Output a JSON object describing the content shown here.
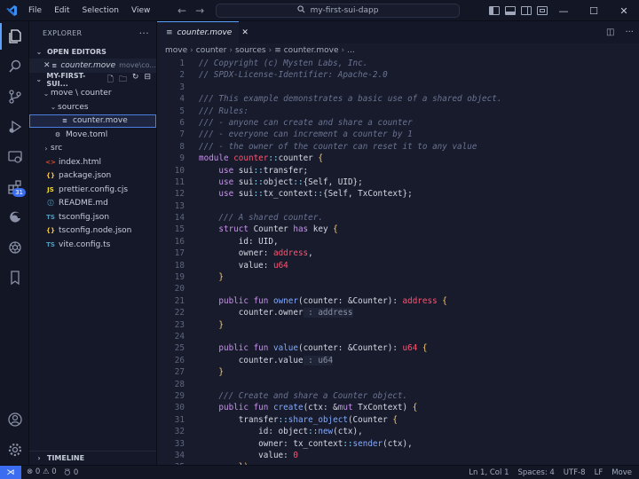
{
  "titlebar": {
    "menu": [
      "File",
      "Edit",
      "Selection",
      "View"
    ],
    "command_center": "my-first-sui-dapp",
    "window_controls": [
      "minimize",
      "maximize",
      "close"
    ]
  },
  "activity_bar": {
    "items": [
      "explorer-icon",
      "search-icon",
      "source-control-icon",
      "run-debug-icon",
      "remote-explorer-icon",
      "extensions-icon",
      "edge-icon",
      "openai-icon",
      "bookmark-icon"
    ],
    "extensions_badge": "31",
    "bottom": [
      "account-icon",
      "manage-gear-icon"
    ]
  },
  "sidebar": {
    "title": "EXPLORER",
    "open_editors_label": "OPEN EDITORS",
    "open_editor": {
      "name": "counter.move",
      "path": "move\\co..."
    },
    "folder_label": "MY-FIRST-SUI...",
    "tree": [
      {
        "label": "move \\ counter",
        "kind": "folder-open",
        "depth": 1
      },
      {
        "label": "sources",
        "kind": "folder-open",
        "depth": 2
      },
      {
        "label": "counter.move",
        "kind": "file-move",
        "depth": 3,
        "selected": true
      },
      {
        "label": "Move.toml",
        "kind": "file-gear",
        "depth": 2
      },
      {
        "label": "src",
        "kind": "folder-closed",
        "depth": 1
      },
      {
        "label": "index.html",
        "kind": "file-html",
        "depth": 1
      },
      {
        "label": "package.json",
        "kind": "file-json",
        "depth": 1
      },
      {
        "label": "prettier.config.cjs",
        "kind": "file-js",
        "depth": 1
      },
      {
        "label": "README.md",
        "kind": "file-info",
        "depth": 1
      },
      {
        "label": "tsconfig.json",
        "kind": "file-ts",
        "depth": 1
      },
      {
        "label": "tsconfig.node.json",
        "kind": "file-json",
        "depth": 1
      },
      {
        "label": "vite.config.ts",
        "kind": "file-ts",
        "depth": 1
      }
    ],
    "timeline_label": "TIMELINE"
  },
  "editor": {
    "tab_label": "counter.move",
    "breadcrumb": [
      "move",
      "counter",
      "sources",
      "counter.move",
      "..."
    ],
    "lines": [
      [
        [
          "comment",
          "// Copyright (c) Mysten Labs, Inc."
        ]
      ],
      [
        [
          "comment",
          "// SPDX-License-Identifier: Apache-2.0"
        ]
      ],
      [
        [
          "plain",
          ""
        ]
      ],
      [
        [
          "comment",
          "/// This example demonstrates a basic use of a shared object."
        ]
      ],
      [
        [
          "comment",
          "/// Rules:"
        ]
      ],
      [
        [
          "comment",
          "/// - anyone can create and share a counter"
        ]
      ],
      [
        [
          "comment",
          "/// - everyone can increment a counter by 1"
        ]
      ],
      [
        [
          "comment",
          "/// - the owner of the counter can reset it to any value"
        ]
      ],
      [
        [
          "kw",
          "module "
        ],
        [
          "red",
          "counter"
        ],
        [
          "op",
          "::"
        ],
        [
          "plain",
          "counter "
        ],
        [
          "ty",
          "{"
        ]
      ],
      [
        [
          "plain",
          "    "
        ],
        [
          "kw",
          "use "
        ],
        [
          "plain",
          "sui"
        ],
        [
          "op",
          "::"
        ],
        [
          "plain",
          "transfer;"
        ]
      ],
      [
        [
          "plain",
          "    "
        ],
        [
          "kw",
          "use "
        ],
        [
          "plain",
          "sui"
        ],
        [
          "op",
          "::"
        ],
        [
          "plain",
          "object"
        ],
        [
          "op",
          "::"
        ],
        [
          "plain",
          "{Self, UID};"
        ]
      ],
      [
        [
          "plain",
          "    "
        ],
        [
          "kw",
          "use "
        ],
        [
          "plain",
          "sui"
        ],
        [
          "op",
          "::"
        ],
        [
          "plain",
          "tx_context"
        ],
        [
          "op",
          "::"
        ],
        [
          "plain",
          "{Self, TxContext};"
        ]
      ],
      [
        [
          "plain",
          ""
        ]
      ],
      [
        [
          "plain",
          "    "
        ],
        [
          "comment",
          "/// A shared counter."
        ]
      ],
      [
        [
          "plain",
          "    "
        ],
        [
          "kw",
          "struct "
        ],
        [
          "plain",
          "Counter "
        ],
        [
          "kw",
          "has "
        ],
        [
          "plain",
          "key "
        ],
        [
          "ty",
          "{"
        ]
      ],
      [
        [
          "plain",
          "        id: UID,"
        ]
      ],
      [
        [
          "plain",
          "        owner: "
        ],
        [
          "red",
          "address"
        ],
        [
          "plain",
          ","
        ]
      ],
      [
        [
          "plain",
          "        value: "
        ],
        [
          "red",
          "u64"
        ]
      ],
      [
        [
          "plain",
          "    "
        ],
        [
          "ty",
          "}"
        ]
      ],
      [
        [
          "plain",
          ""
        ]
      ],
      [
        [
          "plain",
          "    "
        ],
        [
          "kw",
          "public fun "
        ],
        [
          "fn",
          "owner"
        ],
        [
          "plain",
          "(counter: &Counter): "
        ],
        [
          "red",
          "address "
        ],
        [
          "ty",
          "{"
        ]
      ],
      [
        [
          "plain",
          "        counter.owner"
        ],
        [
          "hint",
          " : address"
        ]
      ],
      [
        [
          "plain",
          "    "
        ],
        [
          "ty",
          "}"
        ]
      ],
      [
        [
          "plain",
          ""
        ]
      ],
      [
        [
          "plain",
          "    "
        ],
        [
          "kw",
          "public fun "
        ],
        [
          "fn",
          "value"
        ],
        [
          "plain",
          "(counter: &Counter): "
        ],
        [
          "red",
          "u64 "
        ],
        [
          "ty",
          "{"
        ]
      ],
      [
        [
          "plain",
          "        counter.value"
        ],
        [
          "hint",
          " : u64"
        ]
      ],
      [
        [
          "plain",
          "    "
        ],
        [
          "ty",
          "}"
        ]
      ],
      [
        [
          "plain",
          ""
        ]
      ],
      [
        [
          "plain",
          "    "
        ],
        [
          "comment",
          "/// Create and share a Counter object."
        ]
      ],
      [
        [
          "plain",
          "    "
        ],
        [
          "kw",
          "public fun "
        ],
        [
          "fn",
          "create"
        ],
        [
          "plain",
          "(ctx: &"
        ],
        [
          "kw",
          "mut "
        ],
        [
          "plain",
          "TxContext) "
        ],
        [
          "ty",
          "{"
        ]
      ],
      [
        [
          "plain",
          "        transfer"
        ],
        [
          "op",
          "::"
        ],
        [
          "fn",
          "share_object"
        ],
        [
          "plain",
          "(Counter "
        ],
        [
          "ty",
          "{"
        ]
      ],
      [
        [
          "plain",
          "            id: object"
        ],
        [
          "op",
          "::"
        ],
        [
          "fn",
          "new"
        ],
        [
          "plain",
          "(ctx),"
        ]
      ],
      [
        [
          "plain",
          "            owner: tx_context"
        ],
        [
          "op",
          "::"
        ],
        [
          "fn",
          "sender"
        ],
        [
          "plain",
          "(ctx),"
        ]
      ],
      [
        [
          "plain",
          "            value: "
        ],
        [
          "red",
          "0"
        ]
      ],
      [
        [
          "plain",
          "        "
        ],
        [
          "ty",
          "})"
        ],
        [
          "plain",
          ";"
        ]
      ]
    ]
  },
  "statusbar": {
    "errors": "0",
    "warnings": "0",
    "ports": "0",
    "position": "Ln 1, Col 1",
    "spaces": "Spaces: 4",
    "encoding": "UTF-8",
    "eol": "LF",
    "language": "Move"
  },
  "colors": {
    "accent": "#3a6df0",
    "keyword": "#c792ea",
    "function": "#82aaff",
    "string_red": "#ff5370"
  }
}
